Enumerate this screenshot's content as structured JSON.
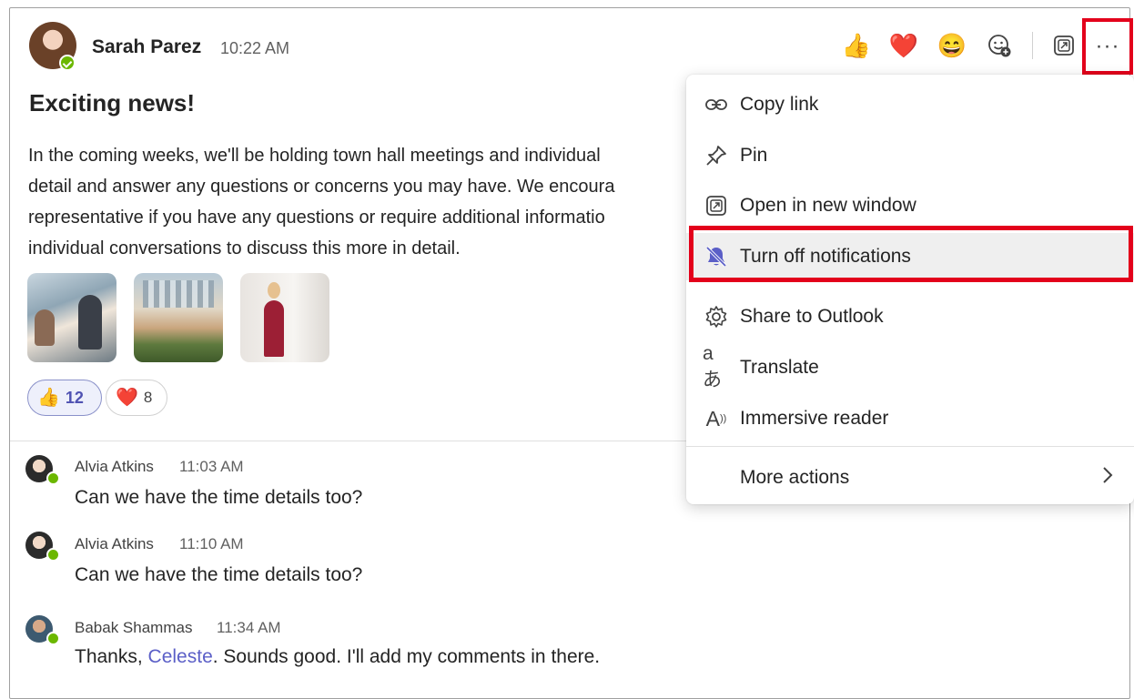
{
  "post": {
    "author": "Sarah Parez",
    "time": "10:22 AM",
    "subject": "Exciting news!",
    "body_lines": [
      "In the coming weeks, we'll be holding town hall meetings and individual",
      "detail and answer any questions or concerns you may have. We encoura",
      "representative if you have any questions or require additional informatio",
      "individual conversations to discuss this more in detail."
    ],
    "reactions": [
      {
        "emoji": "👍",
        "count": "12"
      },
      {
        "emoji": "❤️",
        "count": "8"
      }
    ]
  },
  "toolbar": {
    "reactions": [
      "👍",
      "❤️",
      "😄"
    ],
    "more_label": "···"
  },
  "replies": [
    {
      "name": "Alvia Atkins",
      "time": "11:03 AM",
      "message": "Can we have the time details too?"
    },
    {
      "name": "Alvia Atkins",
      "time": "11:10 AM",
      "message": "Can we have the time details too?"
    },
    {
      "name": "Babak Shammas",
      "time": "11:34 AM",
      "message_before": "Thanks, ",
      "mention": "Celeste",
      "message_after": ". Sounds good. I'll add my comments in there."
    }
  ],
  "menu": {
    "items": [
      {
        "label": "Copy link",
        "icon": "link-icon"
      },
      {
        "label": "Pin",
        "icon": "pin-icon"
      },
      {
        "label": "Open in new window",
        "icon": "open-window-icon"
      },
      {
        "label": "Turn off notifications",
        "icon": "bell-off-icon",
        "highlighted": true
      },
      {
        "label": "Share to Outlook",
        "icon": "gear-icon"
      },
      {
        "label": "Translate",
        "icon": "translate-icon"
      },
      {
        "label": "Immersive reader",
        "icon": "immersive-reader-icon"
      }
    ],
    "more_actions": "More actions"
  },
  "colors": {
    "highlight_outline": "#e3001b",
    "accent": "#5b5fc7",
    "presence": "#6bb700"
  }
}
